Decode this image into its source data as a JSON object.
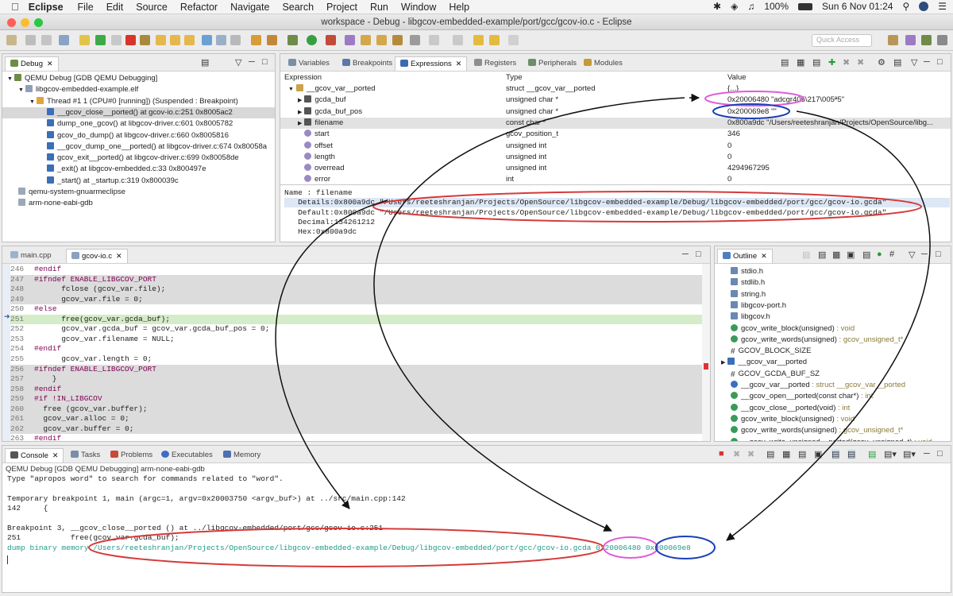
{
  "menubar": {
    "app": "Eclipse",
    "items": [
      "File",
      "Edit",
      "Source",
      "Refactor",
      "Navigate",
      "Search",
      "Project",
      "Run",
      "Window",
      "Help"
    ],
    "battery": "100%",
    "datetime": "Sun 6 Nov  01:24"
  },
  "window": {
    "title": "workspace - Debug - libgcov-embedded-example/port/gcc/gcov-io.c - Eclipse"
  },
  "toolbar": {
    "quick_access": "Quick Access"
  },
  "debug_view": {
    "tab": "Debug",
    "items": [
      "QEMU Debug [GDB QEMU Debugging]",
      "libgcov-embedded-example.elf",
      "Thread #1 1 (CPU#0 [running]) (Suspended : Breakpoint)",
      "__gcov_close__ported() at gcov-io.c:251 0x8005ac2",
      "dump_one_gcov() at libgcov-driver.c:601 0x8005782",
      "gcov_do_dump() at libgcov-driver.c:660 0x8005816",
      "__gcov_dump_one__ported() at libgcov-driver.c:674 0x80058a",
      "gcov_exit__ported() at libgcov-driver.c:699 0x80058de",
      "_exit() at libgcov-embedded.c:33 0x800497e",
      "_start() at _startup.c:319 0x800039c",
      "qemu-system-gnuarmeclipse",
      "arm-none-eabi-gdb"
    ]
  },
  "expr_view": {
    "tabs": [
      "Variables",
      "Breakpoints",
      "Expressions",
      "Registers",
      "Peripherals",
      "Modules"
    ],
    "headers": [
      "Expression",
      "Type",
      "Value"
    ],
    "rows": [
      {
        "name": "__gcov_var__ported",
        "type": "struct __gcov_var__ported",
        "value": "{...}"
      },
      {
        "name": "gcda_buf",
        "type": "unsigned char *",
        "value": "0x20006480 \"adcgr405\\217\\005ª5\""
      },
      {
        "name": "gcda_buf_pos",
        "type": "unsigned char *",
        "value": "0x200069e8 \"\""
      },
      {
        "name": "filename",
        "type": "const char *",
        "value": "0x800a9dc \"/Users/reeteshranjan/Projects/OpenSource/libg..."
      },
      {
        "name": "start",
        "type": "gcov_position_t",
        "value": "346"
      },
      {
        "name": "offset",
        "type": "unsigned int",
        "value": "0"
      },
      {
        "name": "length",
        "type": "unsigned int",
        "value": "0"
      },
      {
        "name": "overread",
        "type": "unsigned int",
        "value": "4294967295"
      },
      {
        "name": "error",
        "type": "int",
        "value": "0"
      }
    ],
    "details": [
      "Name : filename",
      "   Details:0x800a9dc \"/Users/reeteshranjan/Projects/OpenSource/libgcov-embedded-example/Debug/libgcov-embedded/port/gcc/gcov-io.gcda\"",
      "   Default:0x800a9dc \"/Users/reeteshranjan/Projects/OpenSource/libgcov-embedded-example/Debug/libgcov-embedded/port/gcc/gcov-io.gcda\"",
      "   Decimal:134261212",
      "   Hex:0x800a9dc"
    ]
  },
  "editor": {
    "tabs": [
      "main.cpp",
      "gcov-io.c"
    ],
    "lines": [
      {
        "n": "246",
        "t": "#endif"
      },
      {
        "n": "247",
        "t": "#ifndef ENABLE_LIBGCOV_PORT"
      },
      {
        "n": "248",
        "t": "      fclose (gcov_var.file);"
      },
      {
        "n": "249",
        "t": "      gcov_var.file = 0;"
      },
      {
        "n": "250",
        "t": "#else"
      },
      {
        "n": "251",
        "t": "      free(gcov_var.gcda_buf);"
      },
      {
        "n": "252",
        "t": "      gcov_var.gcda_buf = gcov_var.gcda_buf_pos = 0;"
      },
      {
        "n": "253",
        "t": "      gcov_var.filename = NULL;"
      },
      {
        "n": "254",
        "t": "#endif"
      },
      {
        "n": "255",
        "t": "      gcov_var.length = 0;"
      },
      {
        "n": "256",
        "t": "#ifndef ENABLE_LIBGCOV_PORT"
      },
      {
        "n": "257",
        "t": "    }"
      },
      {
        "n": "258",
        "t": "#endif"
      },
      {
        "n": "259",
        "t": "#if !IN_LIBGCOV"
      },
      {
        "n": "260",
        "t": "  free (gcov_var.buffer);"
      },
      {
        "n": "261",
        "t": "  gcov_var.alloc = 0;"
      },
      {
        "n": "262",
        "t": "  gcov_var.buffer = 0;"
      },
      {
        "n": "263",
        "t": "#endif"
      }
    ]
  },
  "outline": {
    "tab": "Outline",
    "items": [
      {
        "name": "stdio.h",
        "type": ""
      },
      {
        "name": "stdlib.h",
        "type": ""
      },
      {
        "name": "string.h",
        "type": ""
      },
      {
        "name": "libgcov-port.h",
        "type": ""
      },
      {
        "name": "libgcov.h",
        "type": ""
      },
      {
        "name": "gcov_write_block(unsigned)",
        "type": " : void"
      },
      {
        "name": "gcov_write_words(unsigned)",
        "type": " : gcov_unsigned_t*"
      },
      {
        "name": "GCOV_BLOCK_SIZE",
        "type": ""
      },
      {
        "name": "__gcov_var__ported",
        "type": ""
      },
      {
        "name": "GCOV_GCDA_BUF_SZ",
        "type": ""
      },
      {
        "name": "__gcov_var__ported",
        "type": " : struct __gcov_var__ported"
      },
      {
        "name": "__gcov_open__ported(const char*)",
        "type": " : int"
      },
      {
        "name": "__gcov_close__ported(void)",
        "type": " : int"
      },
      {
        "name": "gcov_write_block(unsigned)",
        "type": " : void"
      },
      {
        "name": "gcov_write_words(unsigned)",
        "type": " : gcov_unsigned_t*"
      },
      {
        "name": "__gcov_write_unsigned__ported(gcov_unsigned_t)",
        "type": " : void"
      }
    ]
  },
  "console": {
    "tabs": [
      "Console",
      "Tasks",
      "Problems",
      "Executables",
      "Memory"
    ],
    "header": "QEMU Debug [GDB QEMU Debugging] arm-none-eabi-gdb",
    "lines": [
      "Type \"apropos word\" to search for commands related to \"word\".",
      "",
      "Temporary breakpoint 1, main (argc=1, argv=0x20003750 <argv_buf>) at ../src/main.cpp:142",
      "142     {",
      "",
      "Breakpoint 3, __gcov_close__ported () at ../libgcov-embedded/port/gcc/gcov-io.c:251",
      "251           free(gcov_var.gcda_buf);"
    ],
    "command": "dump binary memory /Users/reeteshranjan/Projects/OpenSource/libgcov-embedded-example/Debug/libgcov-embedded/port/gcc/gcov-io.gcda 0x20006480 0x200069e8"
  },
  "colors": {
    "pink": "#e05bd8",
    "blue": "#1a3fb8",
    "red": "#d63a3a",
    "teal": "#1f9a8a"
  }
}
